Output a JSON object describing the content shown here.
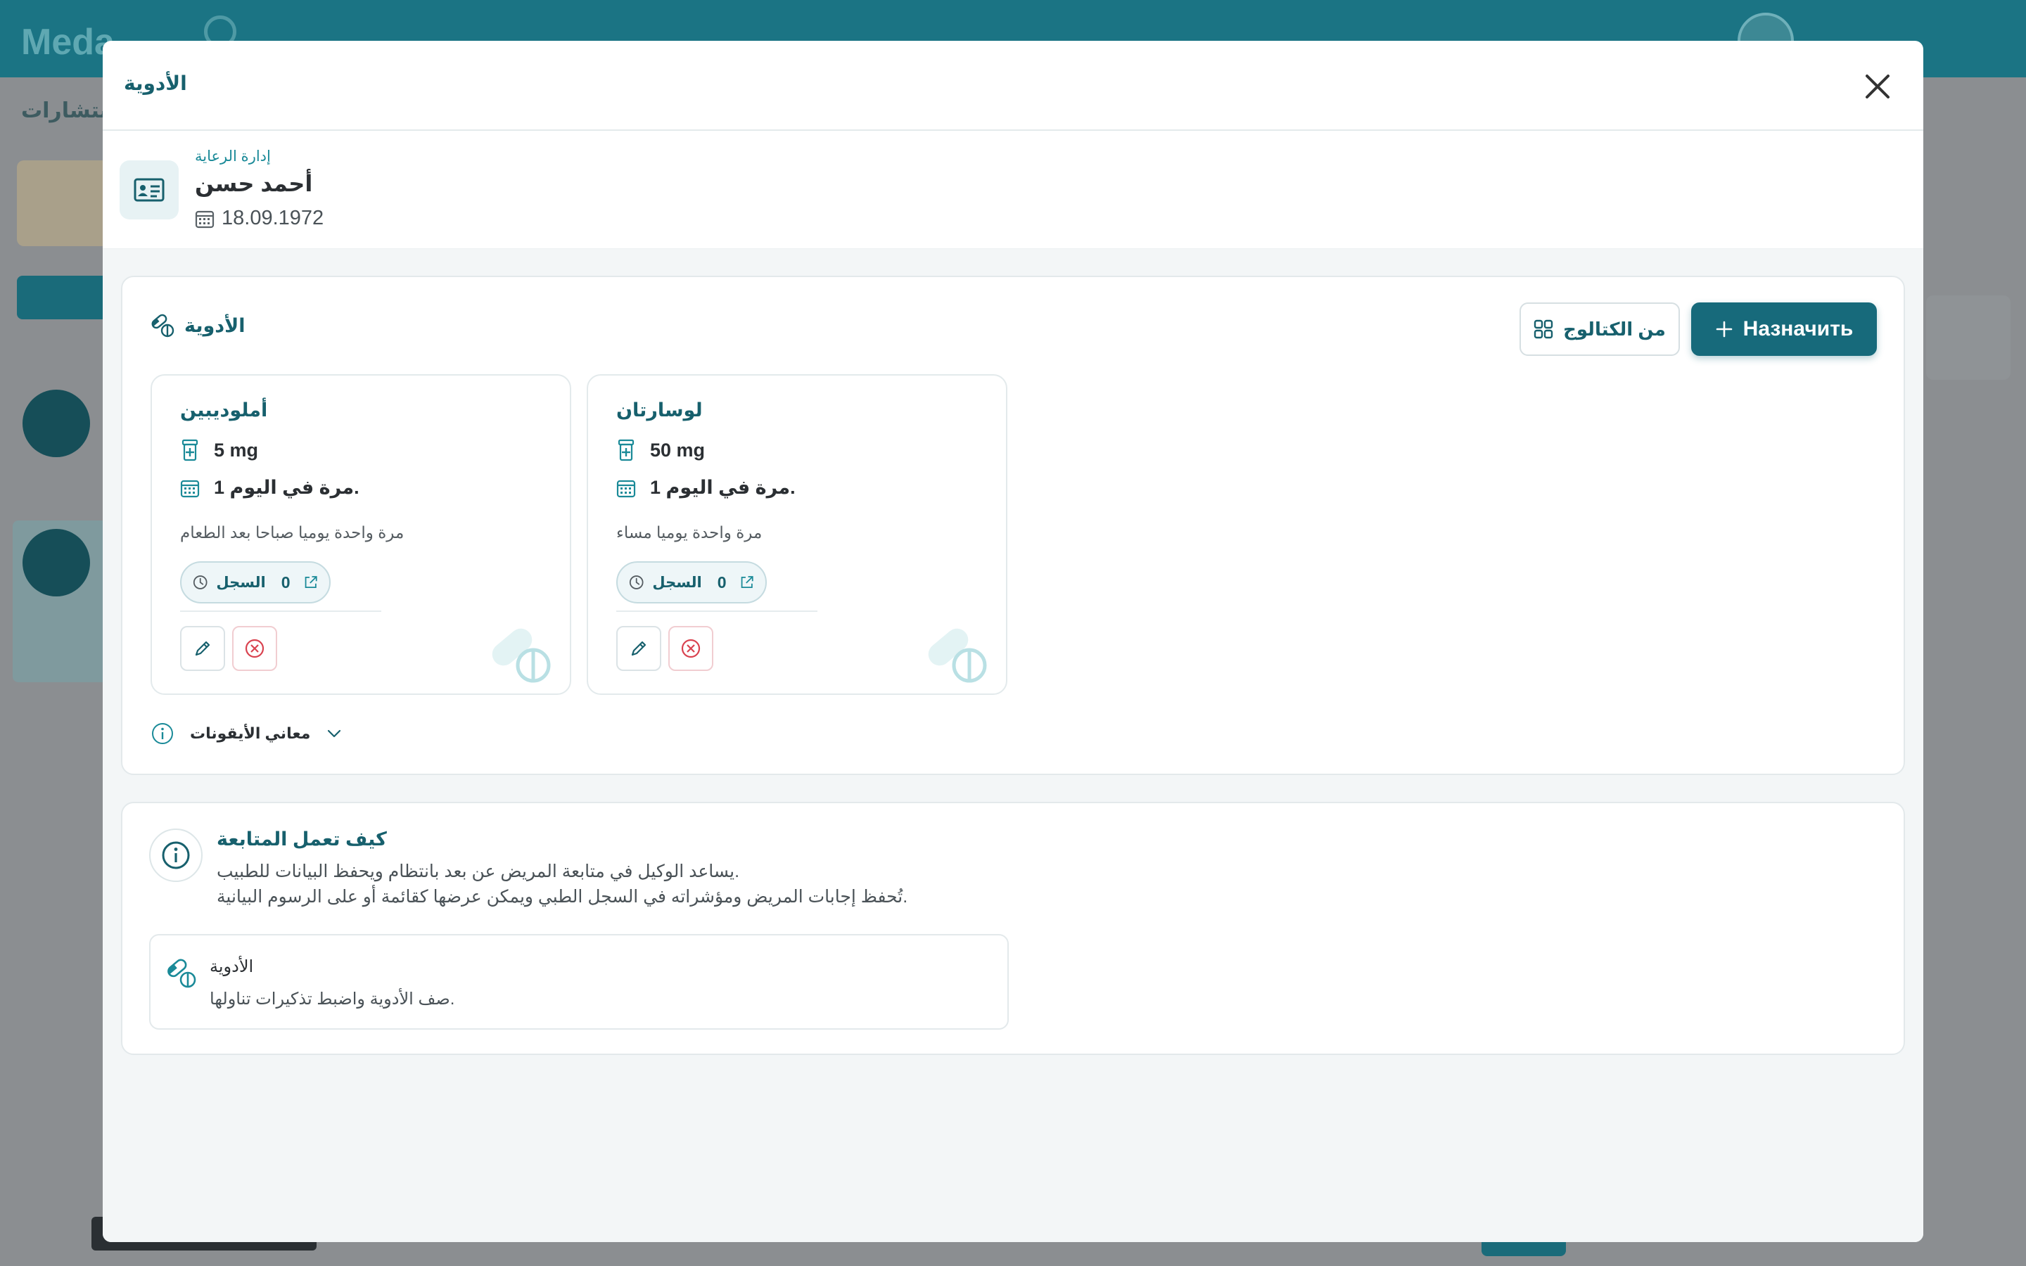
{
  "background": {
    "logo_text": "Meda",
    "subnav_text": "الاستشارات"
  },
  "modal": {
    "title": "الأدوية",
    "patient": {
      "care_link": "إدارة الرعاية",
      "name": "أحمد حسن",
      "dob": "18.09.1972"
    },
    "medications_section": {
      "title": "الأدوية",
      "catalog_button": "من الكتالوج",
      "assign_button": "Назначить",
      "cards": [
        {
          "name": "أملوديبين",
          "dose": "5 mg",
          "frequency": "1 مرة في اليوم.",
          "note": "مرة واحدة يوميا صباحا بعد الطعام",
          "log_label": "السجل",
          "log_count": "0"
        },
        {
          "name": "لوسارتان",
          "dose": "50 mg",
          "frequency": "1 مرة في اليوم.",
          "note": "مرة واحدة يوميا مساء",
          "log_label": "السجل",
          "log_count": "0"
        }
      ],
      "legend_label": "معاني الأيقونات"
    },
    "how_it_works": {
      "title": "كيف تعمل المتابعة",
      "line1": "يساعد الوكيل في متابعة المريض عن بعد بانتظام ويحفظ البيانات للطبيب.",
      "line2": "تُحفظ إجابات المريض ومؤشراته في السجل الطبي ويمكن عرضها كقائمة أو على الرسوم البيانية.",
      "feature": {
        "title": "الأدوية",
        "description": "صف الأدوية واضبط تذكيرات تناولها."
      }
    }
  },
  "colors": {
    "primary": "#176a7b",
    "accent": "#1a8a98",
    "danger": "#d9424f",
    "background_header": "#1b7484"
  },
  "icons": [
    "close-icon",
    "id-card-icon",
    "calendar-icon",
    "pills-icon",
    "grid-icon",
    "plus-icon",
    "medicine-bottle-icon",
    "clock-icon",
    "external-link-icon",
    "pencil-icon",
    "x-circle-icon",
    "info-icon",
    "chevron-down-icon"
  ]
}
